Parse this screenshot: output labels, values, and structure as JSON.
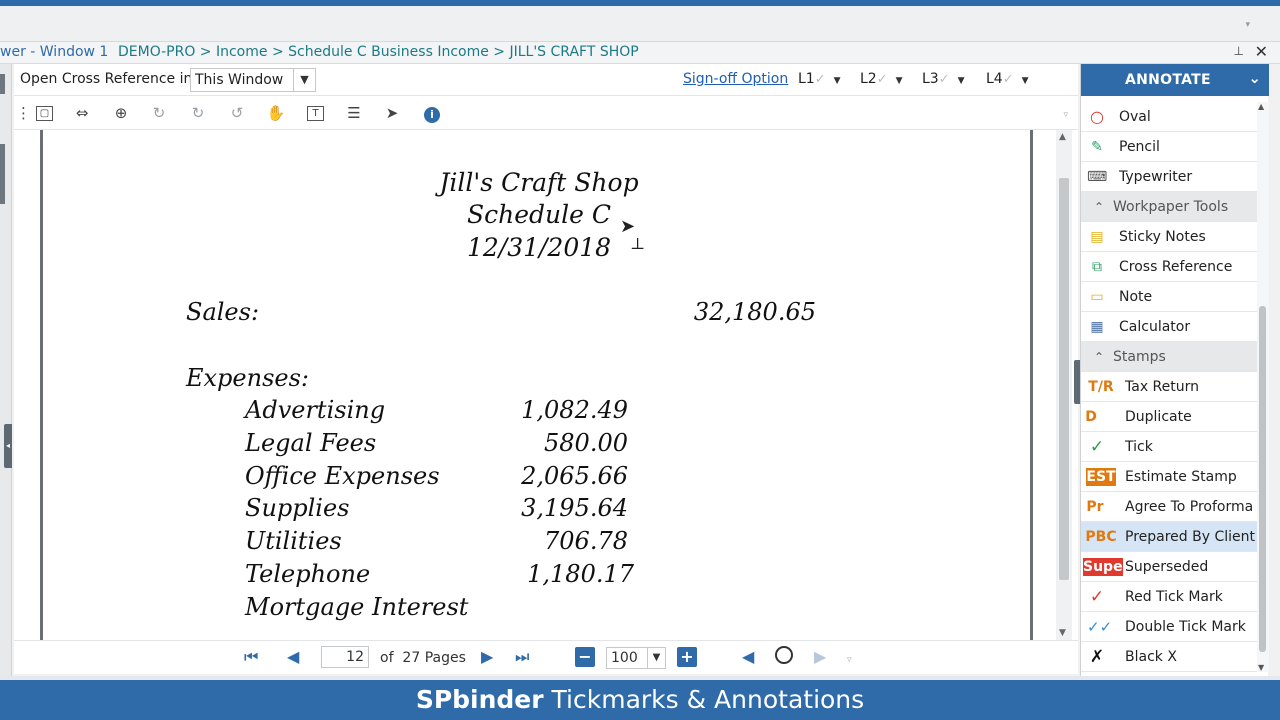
{
  "window": {
    "title_partial": "wer - Window 1",
    "breadcrumb": "DEMO-PRO > Income > Schedule C Business Income  > JILL'S CRAFT SHOP",
    "pin": "⊥",
    "close": "✕"
  },
  "options": {
    "open_xref_label": "Open Cross Reference in:",
    "open_xref_value": "This Window",
    "signoff_label": "Sign-off Option",
    "levels": [
      {
        "label": "L1",
        "check": "✓"
      },
      {
        "label": "L2",
        "check": "✓"
      },
      {
        "label": "L3",
        "check": "✓"
      },
      {
        "label": "L4",
        "check": "✓"
      }
    ]
  },
  "document": {
    "company": "Jill's Craft Shop",
    "form": "Schedule C",
    "date": "12/31/2018",
    "sales_label": "Sales:",
    "sales_value": "32,180.65",
    "expenses_label": "Expenses:",
    "expenses": [
      {
        "name": "Advertising",
        "amount": "1,082.49"
      },
      {
        "name": "Legal Fees",
        "amount": "580.00"
      },
      {
        "name": "Office Expenses",
        "amount": "2,065.66"
      },
      {
        "name": "Supplies",
        "amount": "3,195.64"
      },
      {
        "name": "Utilities",
        "amount": "706.78"
      },
      {
        "name": "Telephone",
        "amount": "1,180.17"
      },
      {
        "name": "Mortgage Interest",
        "amount": ""
      }
    ]
  },
  "pager": {
    "current_page": "12",
    "of_label": "of",
    "total_pages": "27",
    "pages_label": "Pages",
    "zoom": "100"
  },
  "annotate": {
    "header": "ANNOTATE",
    "items": [
      {
        "label": "Oval"
      },
      {
        "label": "Pencil"
      },
      {
        "label": "Typewriter"
      },
      {
        "label": "Workpaper Tools"
      },
      {
        "label": "Sticky Notes"
      },
      {
        "label": "Cross Reference"
      },
      {
        "label": "Note"
      },
      {
        "label": "Calculator"
      },
      {
        "label": "Stamps"
      },
      {
        "label": "Tax Return",
        "badge": "T/R"
      },
      {
        "label": "Duplicate",
        "badge": "D"
      },
      {
        "label": "Tick"
      },
      {
        "label": "Estimate Stamp",
        "badge": "EST"
      },
      {
        "label": "Agree To Proforma",
        "badge": "Pr"
      },
      {
        "label": "Prepared By Client",
        "badge": "PBC"
      },
      {
        "label": "Superseded",
        "badge": "Super"
      },
      {
        "label": "Red Tick Mark"
      },
      {
        "label": "Double Tick Mark"
      },
      {
        "label": "Black X"
      }
    ]
  },
  "footer": {
    "brand": "SPbinder",
    "title": "Tickmarks & Annotations"
  },
  "colors": {
    "brand_blue": "#2f6aa9",
    "selected_row": "#d6e5f6",
    "breadcrumb_teal": "#1c7a86"
  }
}
